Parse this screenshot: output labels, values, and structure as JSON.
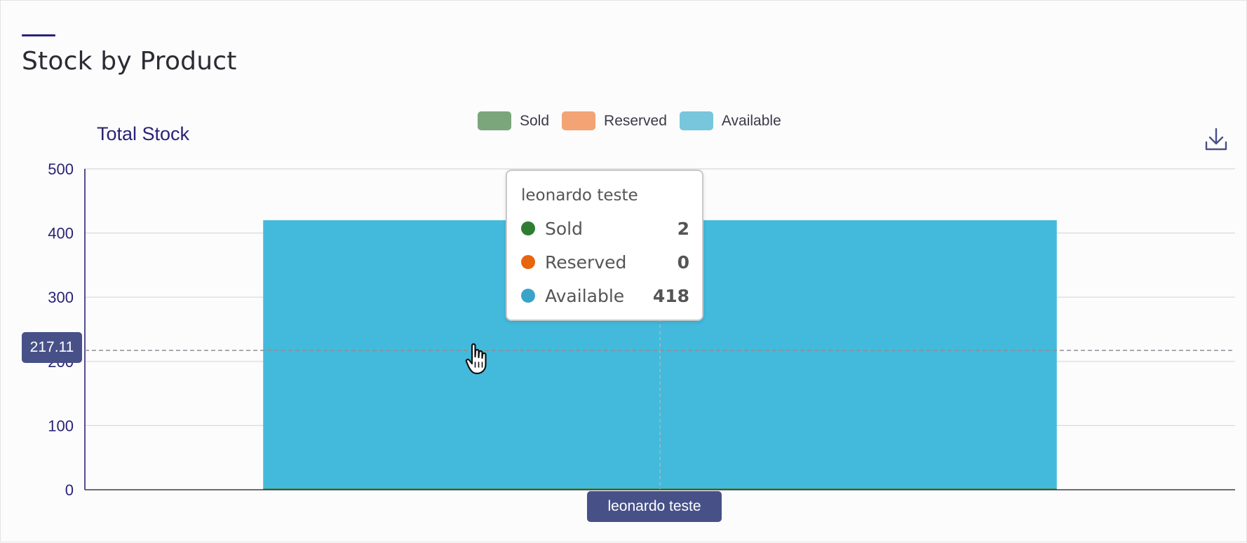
{
  "page": {
    "title": "Stock by Product"
  },
  "chart_data": {
    "type": "bar",
    "stacked": true,
    "title": "Stock by Product",
    "ylabel": "Total Stock",
    "xlabel": "",
    "categories": [
      "leonardo teste"
    ],
    "series": [
      {
        "name": "Sold",
        "values": [
          2
        ],
        "color": "#2e7d32",
        "legend_color": "#7ba67b"
      },
      {
        "name": "Reserved",
        "values": [
          0
        ],
        "color": "#e8650f",
        "legend_color": "#f2a474"
      },
      {
        "name": "Available",
        "values": [
          418
        ],
        "color": "#3fb9da",
        "legend_color": "#78c6db"
      }
    ],
    "ylim": [
      0,
      500
    ],
    "yticks": [
      "0",
      "100",
      "200",
      "300",
      "400",
      "500"
    ],
    "grid": true,
    "legend_position": "top-center"
  },
  "tooltip": {
    "title": "leonardo teste",
    "rows": [
      {
        "name": "Sold",
        "value": "2",
        "color": "#2e7d32"
      },
      {
        "name": "Reserved",
        "value": "0",
        "color": "#e8650f"
      },
      {
        "name": "Available",
        "value": "418",
        "color": "#3aa4c8"
      }
    ]
  },
  "crosshair": {
    "y_value": "217.11",
    "x_value": "leonardo teste"
  },
  "icons": {
    "download": "download-icon",
    "cursor": "hand-pointer-icon"
  },
  "colors": {
    "accent": "#2a2376",
    "crosshair_label": "#475188"
  }
}
